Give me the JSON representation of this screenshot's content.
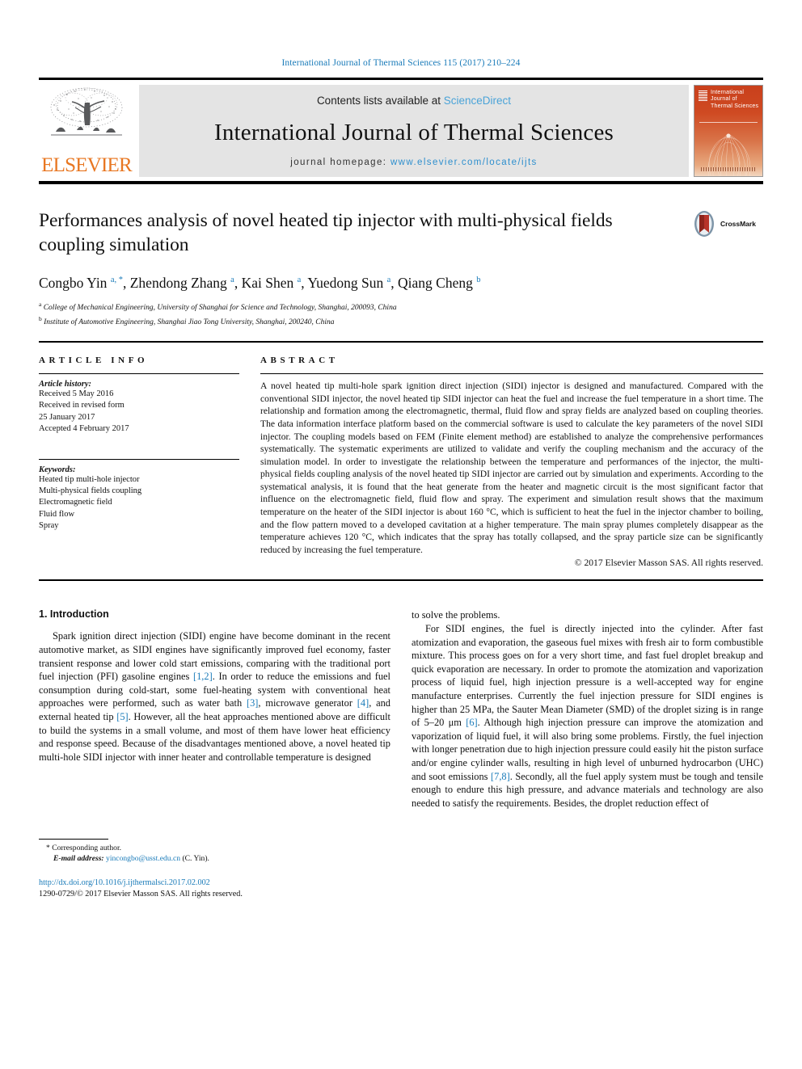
{
  "running_head": "International Journal of Thermal Sciences 115 (2017) 210–224",
  "masthead": {
    "contents_prefix": "Contents lists available at ",
    "sciencedirect": "ScienceDirect",
    "journal_title": "International Journal of Thermal Sciences",
    "homepage_prefix": "journal homepage: ",
    "homepage_url": "www.elsevier.com/locate/ijts",
    "publisher": "ELSEVIER",
    "cover_title": "International Journal of Thermal Sciences",
    "accent_orange": "#e87722",
    "accent_blue": "#1a7bb9",
    "cover_red": "#c9401c"
  },
  "article": {
    "title": "Performances analysis of novel heated tip injector with multi-physical fields coupling simulation",
    "crossmark_label": "CrossMark",
    "authors_html": "Congbo Yin <sup>a, *</sup>, Zhendong Zhang <sup>a</sup>, Kai Shen <sup>a</sup>, Yuedong Sun <sup>a</sup>, Qiang Cheng <sup>b</sup>",
    "affiliations": [
      "College of Mechanical Engineering, University of Shanghai for Science and Technology, Shanghai, 200093, China",
      "Institute of Automotive Engineering, Shanghai Jiao Tong University, Shanghai, 200240, China"
    ],
    "affiliation_marks": [
      "a",
      "b"
    ]
  },
  "info": {
    "heading": "ARTICLE INFO",
    "history_label": "Article history:",
    "history": [
      "Received 5 May 2016",
      "Received in revised form",
      "25 January 2017",
      "Accepted 4 February 2017"
    ],
    "keywords_label": "Keywords:",
    "keywords": [
      "Heated tip multi-hole injector",
      "Multi-physical fields coupling",
      "Electromagnetic field",
      "Fluid flow",
      "Spray"
    ]
  },
  "abstract": {
    "heading": "ABSTRACT",
    "text": "A novel heated tip multi-hole spark ignition direct injection (SIDI) injector is designed and manufactured. Compared with the conventional SIDI injector, the novel heated tip SIDI injector can heat the fuel and increase the fuel temperature in a short time. The relationship and formation among the electromagnetic, thermal, fluid flow and spray fields are analyzed based on coupling theories. The data information interface platform based on the commercial software is used to calculate the key parameters of the novel SIDI injector. The coupling models based on FEM (Finite element method) are established to analyze the comprehensive performances systematically. The systematic experiments are utilized to validate and verify the coupling mechanism and the accuracy of the simulation model. In order to investigate the relationship between the temperature and performances of the injector, the multi-physical fields coupling analysis of the novel heated tip SIDI injector are carried out by simulation and experiments. According to the systematical analysis, it is found that the heat generate from the heater and magnetic circuit is the most significant factor that influence on the electromagnetic field, fluid flow and spray. The experiment and simulation result shows that the maximum temperature on the heater of the SIDI injector is about 160 °C, which is sufficient to heat the fuel in the injector chamber to boiling, and the flow pattern moved to a developed cavitation at a higher temperature. The main spray plumes completely disappear as the temperature achieves 120 °C, which indicates that the spray has totally collapsed, and the spray particle size can be significantly reduced by increasing the fuel temperature.",
    "copyright": "© 2017 Elsevier Masson SAS. All rights reserved."
  },
  "body": {
    "section_number_title": "1. Introduction",
    "left_paragraph_1_html": "Spark ignition direct injection (SIDI) engine have become dominant in the recent automotive market, as SIDI engines have significantly improved fuel economy, faster transient response and lower cold start emissions, comparing with the traditional port fuel injection (PFI) gasoline engines <span class=\"ref\">[1,2]</span>. In order to reduce the emissions and fuel consumption during cold-start, some fuel-heating system with conventional heat approaches were performed, such as water bath <span class=\"ref\">[3]</span>, microwave generator <span class=\"ref\">[4]</span>, and external heated tip <span class=\"ref\">[5]</span>. However, all the heat approaches mentioned above are difficult to build the systems in a small volume, and most of them have lower heat efficiency and response speed. Because of the disadvantages mentioned above, a novel heated tip multi-hole SIDI injector with inner heater and controllable temperature is designed",
    "right_paragraph_1": "to solve the problems.",
    "right_paragraph_2_html": "For SIDI engines, the fuel is directly injected into the cylinder. After fast atomization and evaporation, the gaseous fuel mixes with fresh air to form combustible mixture. This process goes on for a very short time, and fast fuel droplet breakup and quick evaporation are necessary. In order to promote the atomization and vaporization process of liquid fuel, high injection pressure is a well-accepted way for engine manufacture enterprises. Currently the fuel injection pressure for SIDI engines is higher than 25 MPa, the Sauter Mean Diameter (SMD) of the droplet sizing is in range of 5–20 μm <span class=\"ref\">[6]</span>. Although high injection pressure can improve the atomization and vaporization of liquid fuel, it will also bring some problems. Firstly, the fuel injection with longer penetration due to high injection pressure could easily hit the piston surface and/or engine cylinder walls, resulting in high level of unburned hydrocarbon (UHC) and soot emissions <span class=\"ref\">[7,8]</span>. Secondly, all the fuel apply system must be tough and tensile enough to endure this high pressure, and advance materials and technology are also needed to satisfy the requirements. Besides, the droplet reduction effect of"
  },
  "footer": {
    "corresponding_marker": "*",
    "corresponding_text": "Corresponding author.",
    "email_label": "E-mail address:",
    "email": "yincongbo@usst.edu.cn",
    "email_suffix": "(C. Yin).",
    "doi_url": "http://dx.doi.org/10.1016/j.ijthermalsci.2017.02.002",
    "issn_line": "1290-0729/© 2017 Elsevier Masson SAS. All rights reserved."
  }
}
